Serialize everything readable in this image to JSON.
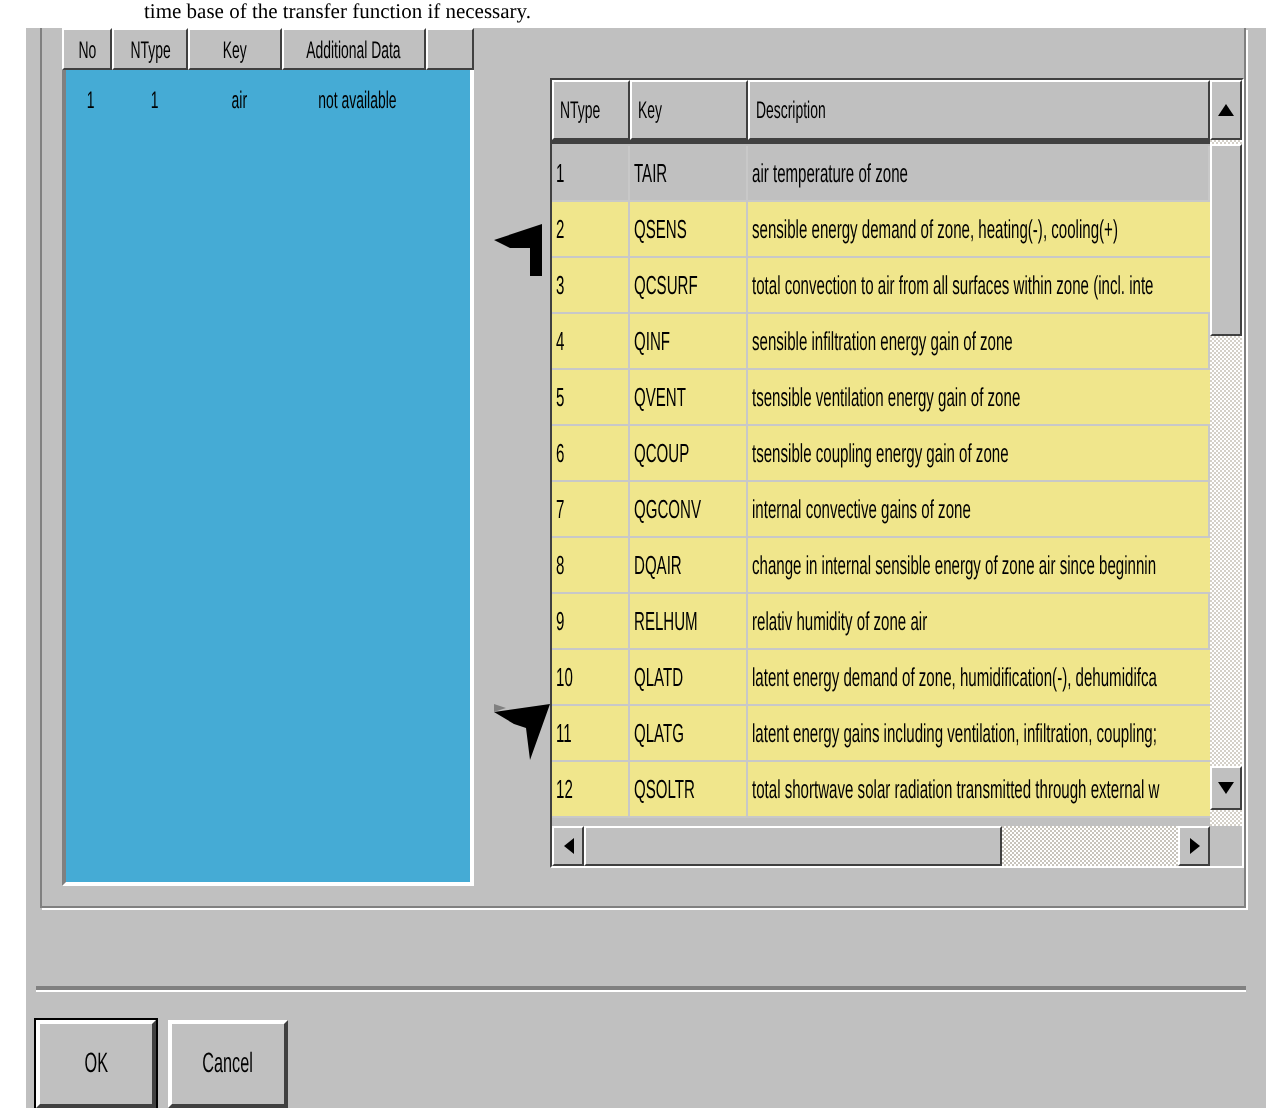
{
  "top_text": "time base of the transfer function if necessary.",
  "inputs": {
    "columns": [
      "No",
      "NType",
      "Key",
      "Additional Data"
    ],
    "rows": [
      {
        "cells": [
          "1",
          "1",
          "air",
          "not available"
        ]
      }
    ]
  },
  "outputs": {
    "columns": [
      "NType",
      "Key",
      "Description"
    ],
    "rows": [
      {
        "cells": [
          "1",
          "TAIR",
          "air temperature of zone"
        ],
        "selected": true
      },
      {
        "cells": [
          "2",
          "QSENS",
          "sensible energy demand of zone, heating(-), cooling(+)"
        ],
        "selected": false
      },
      {
        "cells": [
          "3",
          "QCSURF",
          "total convection to air from all surfaces within zone (incl. inte"
        ],
        "selected": false
      },
      {
        "cells": [
          "4",
          "QINF",
          "sensible infiltration energy gain of zone"
        ],
        "selected": false
      },
      {
        "cells": [
          "5",
          "QVENT",
          "tsensible ventilation energy gain of zone"
        ],
        "selected": false
      },
      {
        "cells": [
          "6",
          "QCOUP",
          "tsensible coupling energy gain of zone"
        ],
        "selected": false
      },
      {
        "cells": [
          "7",
          "QGCONV",
          "internal convective gains of zone"
        ],
        "selected": false
      },
      {
        "cells": [
          "8",
          "DQAIR",
          "change in internal sensible energy of zone air since beginnin"
        ],
        "selected": false
      },
      {
        "cells": [
          "9",
          "RELHUM",
          "relativ humidity of zone air"
        ],
        "selected": false
      },
      {
        "cells": [
          "10",
          "QLATD",
          "latent energy demand of zone, humidification(-), dehumidifca"
        ],
        "selected": false
      },
      {
        "cells": [
          "11",
          "QLATG",
          "latent energy gains including ventilation, infiltration, coupling;"
        ],
        "selected": false
      },
      {
        "cells": [
          "12",
          "QSOLTR",
          "total shortwave solar radiation transmitted through external w"
        ],
        "selected": false
      }
    ]
  },
  "buttons": [
    {
      "label": "OK",
      "default": true
    },
    {
      "label": "Cancel",
      "default": false
    }
  ]
}
